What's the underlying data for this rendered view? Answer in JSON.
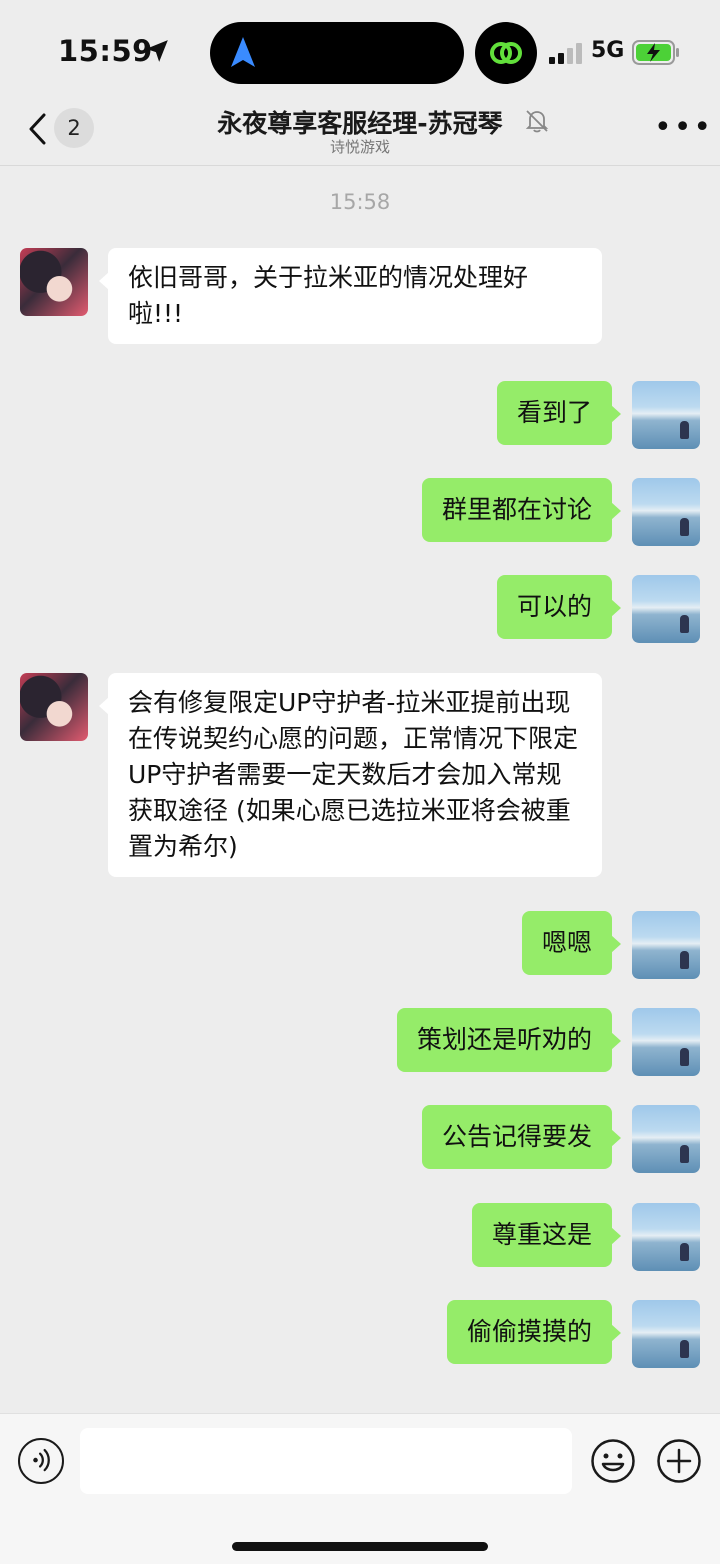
{
  "status_bar": {
    "time": "15:59",
    "network": "5G"
  },
  "header": {
    "unread_count": "2",
    "title": "永夜尊享客服经理-苏冠琴",
    "subtitle": "诗悦游戏"
  },
  "chat": {
    "time_divider": "15:58",
    "messages": [
      {
        "from": "contact",
        "text": "依旧哥哥，关于拉米亚的情况处理好啦!!!"
      },
      {
        "from": "me",
        "text": "看到了"
      },
      {
        "from": "me",
        "text": "群里都在讨论"
      },
      {
        "from": "me",
        "text": "可以的"
      },
      {
        "from": "contact",
        "text": "会有修复限定UP守护者-拉米亚提前出现在传说契约心愿的问题，正常情况下限定UP守护者需要一定天数后才会加入常规获取途径 (如果心愿已选拉米亚将会被重置为希尔)"
      },
      {
        "from": "me",
        "text": "嗯嗯"
      },
      {
        "from": "me",
        "text": "策划还是听劝的"
      },
      {
        "from": "me",
        "text": "公告记得要发"
      },
      {
        "from": "me",
        "text": "尊重这是"
      },
      {
        "from": "me",
        "text": "偷偷摸摸的"
      }
    ]
  },
  "colors": {
    "outgoing_bubble": "#95ec69",
    "incoming_bubble": "#ffffff",
    "background": "#ededed"
  },
  "icons": [
    "location-arrow-icon",
    "navigation-icon",
    "link-icon",
    "signal-icon",
    "battery-charging-icon",
    "back-chevron-icon",
    "mute-bell-icon",
    "more-icon",
    "voice-icon",
    "emoji-icon",
    "add-icon"
  ]
}
